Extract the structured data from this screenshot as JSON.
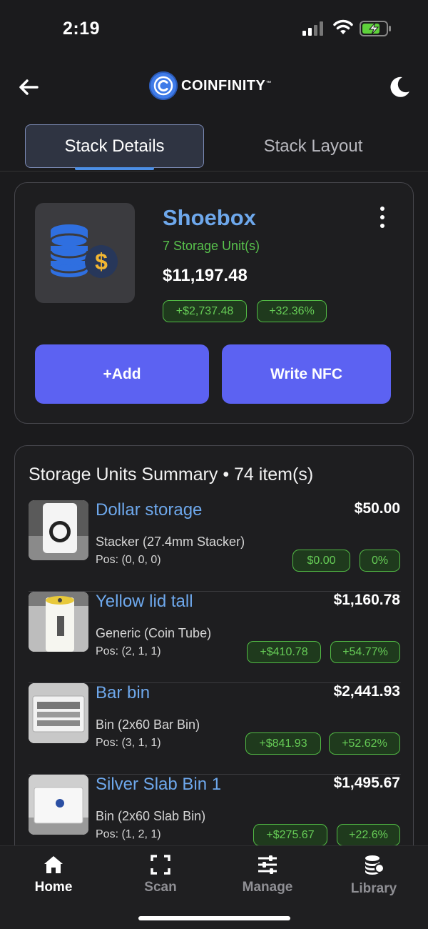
{
  "status_bar": {
    "time": "2:19",
    "icons": [
      "signal-icon",
      "wifi-icon",
      "battery-charging-icon"
    ]
  },
  "header": {
    "brand": "COINFINITY",
    "trademark": "™",
    "icons": [
      "back-arrow-icon",
      "moon-icon"
    ]
  },
  "tabs": [
    {
      "label": "Stack Details",
      "active": true
    },
    {
      "label": "Stack Layout",
      "active": false
    }
  ],
  "stack": {
    "name": "Shoebox",
    "units": "7 Storage Unit(s)",
    "value": "$11,197.48",
    "gain": "+$2,737.48",
    "gain_pct": "+32.36%",
    "add_label": "+Add",
    "nfc_label": "Write NFC"
  },
  "summary": {
    "title": "Storage Units Summary • 74 item(s)",
    "rows": [
      {
        "name": "Dollar storage",
        "type": "Stacker (27.4mm Stacker)",
        "pos": "Pos: (0, 0, 0)",
        "value": "$50.00",
        "gain": "$0.00",
        "pct": "0%"
      },
      {
        "name": "Yellow lid tall",
        "type": "Generic (Coin Tube)",
        "pos": "Pos: (2, 1, 1)",
        "value": "$1,160.78",
        "gain": "+$410.78",
        "pct": "+54.77%"
      },
      {
        "name": "Bar bin",
        "type": "Bin (2x60 Bar Bin)",
        "pos": "Pos: (3, 1, 1)",
        "value": "$2,441.93",
        "gain": "+$841.93",
        "pct": "+52.62%"
      },
      {
        "name": "Silver Slab Bin 1",
        "type": "Bin (2x60 Slab Bin)",
        "pos": "Pos: (1, 2, 1)",
        "value": "$1,495.67",
        "gain": "+$275.67",
        "pct": "+22.6%"
      }
    ]
  },
  "bottom_nav": [
    {
      "label": "Home",
      "icon": "home-icon",
      "active": true
    },
    {
      "label": "Scan",
      "icon": "scan-icon",
      "active": false
    },
    {
      "label": "Manage",
      "icon": "sliders-icon",
      "active": false
    },
    {
      "label": "Library",
      "icon": "coins-stack-icon",
      "active": false
    }
  ],
  "colors": {
    "accent_blue": "#6ea8ec",
    "gain_green": "#58c24c",
    "button_purple": "#5c62f2",
    "background": "#1b1b1d"
  }
}
